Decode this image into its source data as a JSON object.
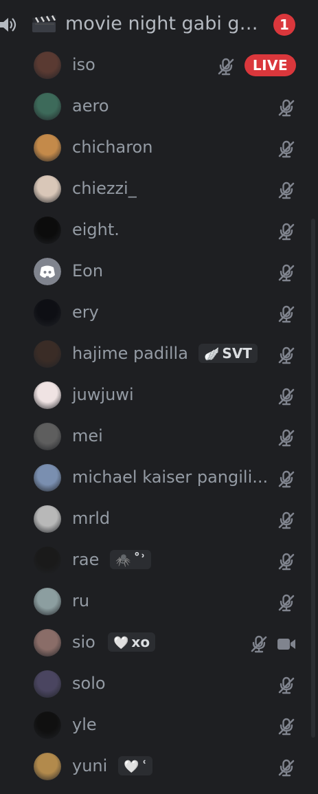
{
  "channel": {
    "name": "movie night gabi ga...",
    "mention_count": "1"
  },
  "users": [
    {
      "name": "iso",
      "live_label": "LIVE",
      "avatar_color": "#5a3a32"
    },
    {
      "name": "aero",
      "avatar_color": "#3d6a5a"
    },
    {
      "name": "chicharon",
      "avatar_color": "#c48a4a"
    },
    {
      "name": "chiezzi_",
      "avatar_color": "#d9c7b8"
    },
    {
      "name": "eight.",
      "avatar_color": "#0c0c0c"
    },
    {
      "name": "Eon",
      "avatar_color": "#80848e"
    },
    {
      "name": "ery",
      "avatar_color": "#0e0f14"
    },
    {
      "name": "hajime padilla",
      "tag_emoji": "🪽",
      "tag_text": "SVT",
      "avatar_color": "#3a2c26"
    },
    {
      "name": "juwjuwi",
      "avatar_color": "#efe3e3"
    },
    {
      "name": "mei",
      "avatar_color": "#5e5e5e"
    },
    {
      "name": "michael kaiser pangili...",
      "avatar_color": "#7a8fb0"
    },
    {
      "name": "mrld",
      "avatar_color": "#b8b8b8"
    },
    {
      "name": "rae",
      "tag_emoji": "🕷️",
      "tag_text": "˚ʾ",
      "avatar_color": "#1a1a1a"
    },
    {
      "name": "ru",
      "avatar_color": "#8c9ea0"
    },
    {
      "name": "sio",
      "tag_emoji": "🤍",
      "tag_text": "xo",
      "avatar_color": "#8a6d68"
    },
    {
      "name": "solo",
      "avatar_color": "#4a4560"
    },
    {
      "name": "yle",
      "avatar_color": "#101010"
    },
    {
      "name": "yuni",
      "tag_emoji": "🤍",
      "tag_text": "ʿ",
      "avatar_color": "#b28a4c"
    }
  ],
  "colors": {
    "background": "#1e1f22",
    "text_muted": "#949ba4",
    "live_red": "#da373c"
  }
}
